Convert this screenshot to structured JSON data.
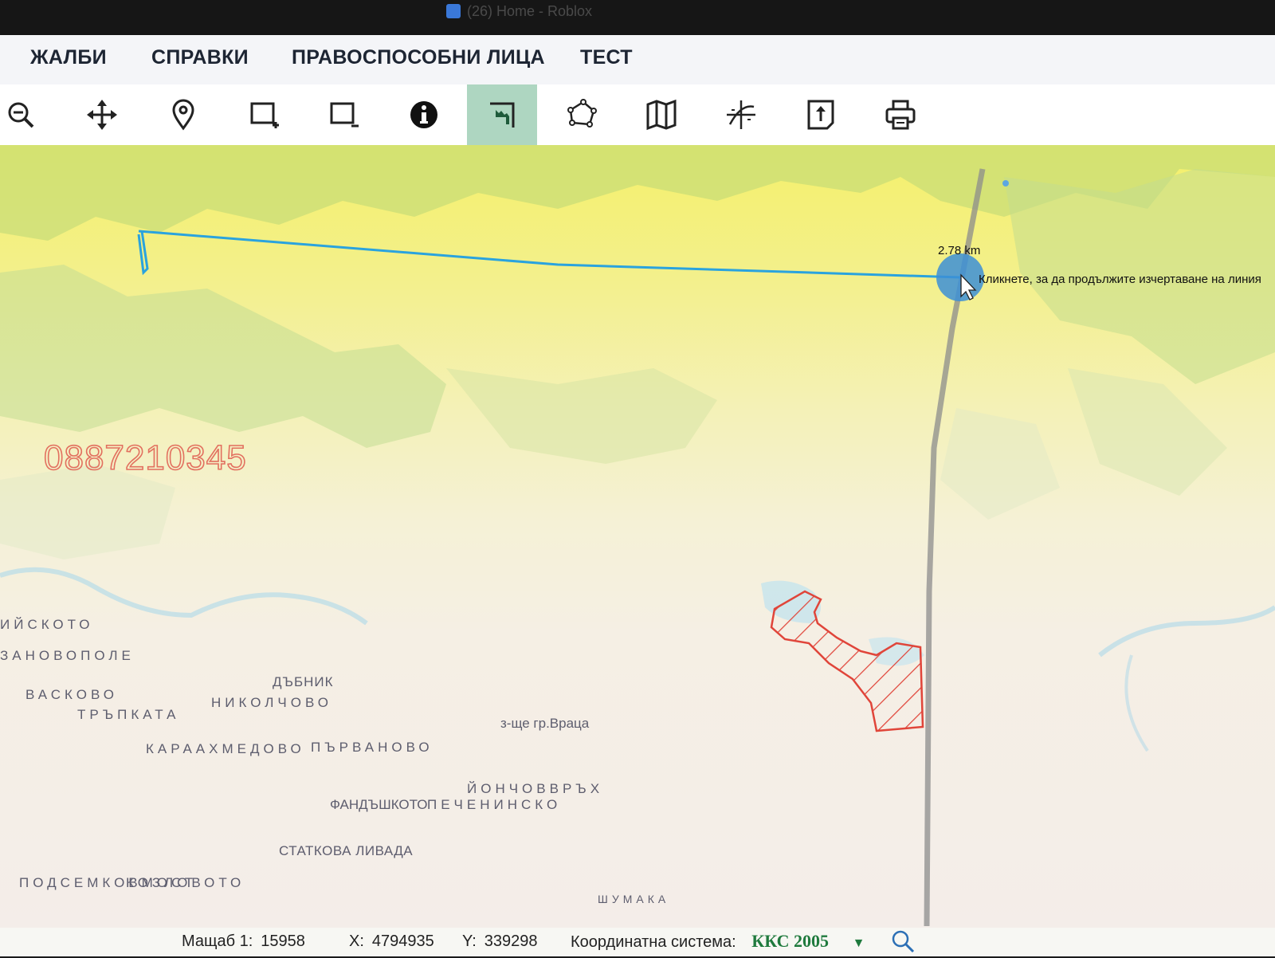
{
  "browser": {
    "tabs": [
      {
        "label": ""
      },
      {
        "label": "(26) Home - Roblox"
      }
    ]
  },
  "menu": {
    "items": [
      "ЖАЛБИ",
      "СПРАВКИ",
      "ПРАВОСПОСОБНИ ЛИЦА",
      "ТЕСТ"
    ]
  },
  "toolbar": {
    "tools": [
      {
        "name": "zoom-out-icon",
        "active": false
      },
      {
        "name": "pan-icon",
        "active": false
      },
      {
        "name": "location-pin-icon",
        "active": false
      },
      {
        "name": "select-add-icon",
        "active": false
      },
      {
        "name": "select-remove-icon",
        "active": false
      },
      {
        "name": "info-icon",
        "active": false
      },
      {
        "name": "measure-distance-icon",
        "active": true
      },
      {
        "name": "measure-area-icon",
        "active": false
      },
      {
        "name": "layers-map-icon",
        "active": false
      },
      {
        "name": "coordinates-icon",
        "active": false
      },
      {
        "name": "export-icon",
        "active": false
      },
      {
        "name": "print-icon",
        "active": false
      }
    ]
  },
  "map": {
    "watermark": "0887210345",
    "measurement": {
      "distance": "2.78 km",
      "hint": "Кликнете, за да продължите изчертаване на линия"
    },
    "places": [
      "ИЙСКОТО",
      "ЗАНОВОПОЛЕ",
      "ВАСКОВО",
      "ДЪБНИК",
      "НИКОЛЧОВО",
      "ТРЪПКАТА",
      "з-ще гр.Враца",
      "КАРААХМЕДОВО",
      "ПЪРВАНОВО",
      "ЙОНЧОВВРЪХ",
      "ФАНДЪШКОТО",
      "ПЕЧЕНИНСКО",
      "СТАТКОВА ЛИВАДА",
      "ПОДСЕМКОВМОСТ",
      "КОЗЛОВОТО",
      "ШУМАКА"
    ]
  },
  "status": {
    "scale_label": "Мащаб 1:",
    "scale_value": "15958",
    "x_label": "X:",
    "x_value": "4794935",
    "y_label": "Y:",
    "y_value": "339298",
    "crs_label": "Координатна система:",
    "crs_value": "ККС 2005"
  },
  "colors": {
    "accent_green": "#1f7a3d",
    "measure_line": "#2aa3de",
    "hatch_red": "#e0453a",
    "watermark": "#e2705f"
  }
}
